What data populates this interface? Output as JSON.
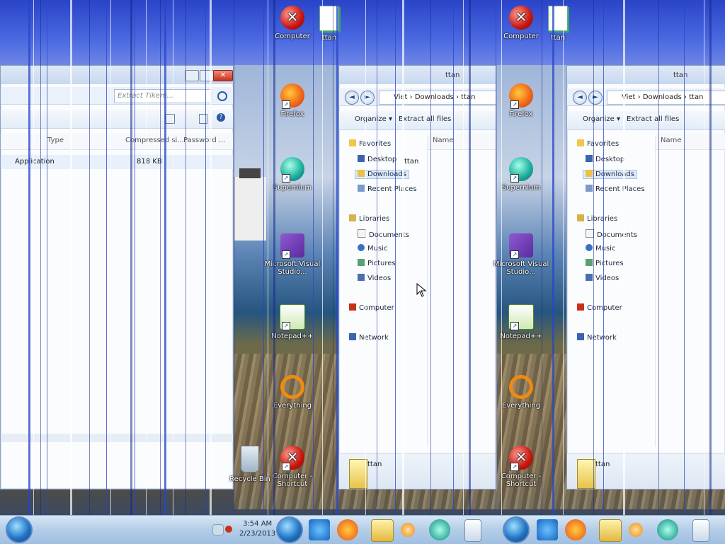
{
  "desktop": {
    "icons_left_col": [
      {
        "label": "Computer",
        "icon": "computer-x-icon"
      },
      {
        "label": "ttan",
        "icon": "document-icon"
      },
      {
        "label": "Firefox",
        "icon": "firefox-icon"
      },
      {
        "label": "Supernium",
        "icon": "supernium-icon"
      },
      {
        "label": "Microsoft Visual Studio...",
        "icon": "visual-studio-icon"
      },
      {
        "label": "Notepad++",
        "icon": "notepad-plus-icon"
      },
      {
        "label": "Everything",
        "icon": "everything-icon"
      },
      {
        "label": "Computer - Shortcut",
        "icon": "computer-x-icon"
      }
    ],
    "recycle_bin_label": "Recycle Bin"
  },
  "left_window": {
    "search_placeholder": "Extract Tikem...",
    "columns": [
      "Type",
      "Compressed si...",
      "Password ..."
    ],
    "rows": [
      {
        "type": "Application",
        "compressed": "818 KB"
      }
    ]
  },
  "right_window": {
    "title": "ttan",
    "breadcrumb": [
      "Viet",
      "Downloads",
      "ttan"
    ],
    "toolbar": {
      "organize": "Organize ▾",
      "extract": "Extract all files"
    },
    "column_name": "Name",
    "file_item": "ttan",
    "nav": {
      "favorites": "Favorites",
      "favorite_items": [
        "Desktop",
        "Downloads",
        "Recent Places"
      ],
      "libraries": "Libraries",
      "library_items": [
        "Documents",
        "Music",
        "Pictures",
        "Videos"
      ],
      "computer": "Computer",
      "network": "Network"
    },
    "details_name": "ttan"
  },
  "taskbar": {
    "clock_time": "3:54 AM",
    "clock_date": "2/23/2013",
    "pinned": [
      "internet-explorer-icon",
      "firefox-icon",
      "explorer-folder-icon",
      "media-player-icon",
      "supernium-icon",
      "notepad-icon"
    ]
  },
  "colors": {
    "sky": "#2a44c8",
    "window_bg": "#fbfcfe",
    "close_red": "#c8321c",
    "taskbar": "#b4cde8"
  }
}
